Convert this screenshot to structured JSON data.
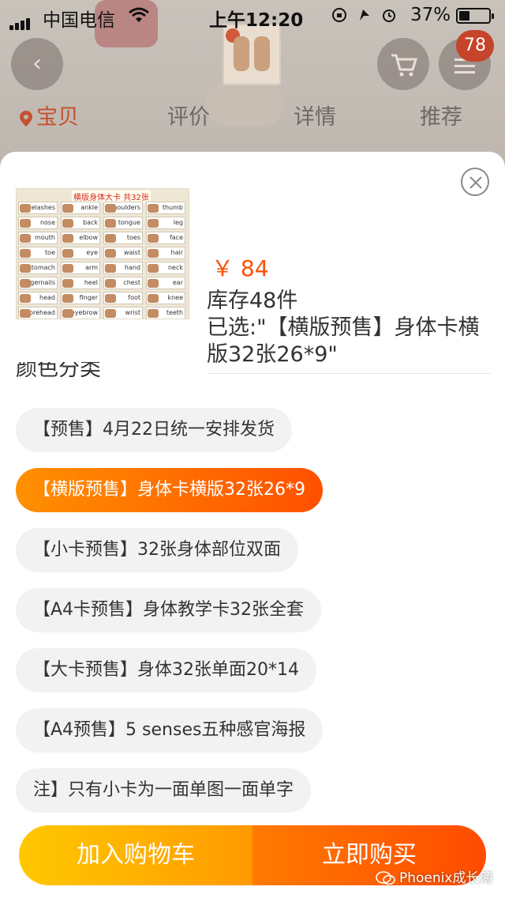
{
  "status_bar": {
    "carrier": "中国电信",
    "time": "上午12:20",
    "battery_percent": "37%",
    "battery_level": 0.37
  },
  "background_page": {
    "cart_badge": "78",
    "tabs": [
      {
        "label": "宝贝",
        "active": true
      },
      {
        "label": "评价",
        "active": false
      },
      {
        "label": "详情",
        "active": false
      },
      {
        "label": "推荐",
        "active": false
      }
    ]
  },
  "product": {
    "image_title": "横版身体大卡 共32张",
    "image_words": [
      "eyelashes",
      "ankle",
      "shoulders",
      "thumb",
      "nose",
      "back",
      "tongue",
      "leg",
      "mouth",
      "elbow",
      "toes",
      "face",
      "toe",
      "eye",
      "waist",
      "hair",
      "stomach",
      "arm",
      "hand",
      "neck",
      "fingernails",
      "heel",
      "chest",
      "ear",
      "head",
      "finger",
      "foot",
      "knee",
      "forehead",
      "eyebrow",
      "wrist",
      "teeth"
    ],
    "price": "￥ 84",
    "stock": "库存48件",
    "selected": "已选:\"【横版预售】身体卡横版32张26*9\""
  },
  "options": {
    "section_title": "颜色分类",
    "items": [
      {
        "label": "【预售】4月22日统一安排发货",
        "selected": false
      },
      {
        "label": "【横版预售】身体卡横版32张26*9",
        "selected": true
      },
      {
        "label": "【小卡预售】32张身体部位双面",
        "selected": false
      },
      {
        "label": "【A4卡预售】身体教学卡32张全套",
        "selected": false
      },
      {
        "label": "【大卡预售】身体32张单面20*14",
        "selected": false
      },
      {
        "label": "【A4预售】5 senses五种感官海报",
        "selected": false
      },
      {
        "label": "注】只有小卡为一面单图一面单字",
        "selected": false
      }
    ]
  },
  "actions": {
    "add_to_cart": "加入购物车",
    "buy_now": "立即购买"
  },
  "watermark": "Phoenix成长簿",
  "colors": {
    "accent": "#ff5000",
    "cart_gradient": [
      "#ffc800",
      "#ff9a00"
    ],
    "buy_gradient": [
      "#ff7a00",
      "#ff4b00"
    ]
  }
}
